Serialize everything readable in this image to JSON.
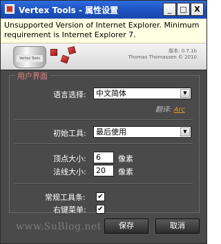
{
  "window": {
    "title": "Vertex Tools - 属性设置",
    "minimize_symbol": "_",
    "maximize_symbol": "□",
    "close_symbol": "X"
  },
  "info_bar": {
    "message": "Unsupported Version of Internet Explorer. Minimum requirement is Internet Explorer 7."
  },
  "banner": {
    "version": "版本: 0.7.1b",
    "author": "Thomas Thomassen © 2010",
    "jar_label": "Vertex Tools"
  },
  "panel": {
    "legend": "用户界面",
    "language_label": "语言选择:",
    "language_value": "中文简体",
    "translator_prefix": "翻译:",
    "translator_name": "Arc",
    "initial_tool_label": "初始工具:",
    "initial_tool_value": "最后使用",
    "vertex_size_label": "顶点大小:",
    "vertex_size_value": "6",
    "vertex_size_unit": "像素",
    "normal_size_label": "法线大小:",
    "normal_size_value": "20",
    "normal_size_unit": "像素",
    "toolbar_label": "常规工具条:",
    "toolbar_checked": true,
    "context_menu_label": "右键菜单:",
    "context_menu_checked": true,
    "check_mark": "✔",
    "dropdown_arrow": "▼"
  },
  "footer": {
    "watermark": "www.SuBlog.net",
    "save_label": "保存",
    "cancel_label": "取消"
  },
  "colors": {
    "title_bar": "#1f54c3",
    "panel_bg": "#4a4a4a",
    "info_bar": "#ffffe1",
    "legend": "#e88080",
    "link": "#e39a2b"
  }
}
